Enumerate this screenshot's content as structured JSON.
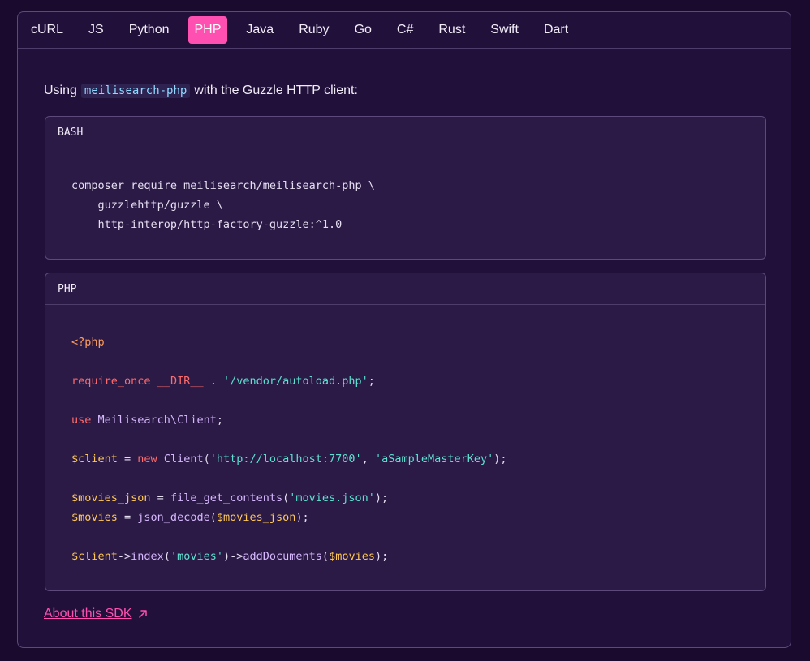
{
  "tabs": [
    "cURL",
    "JS",
    "Python",
    "PHP",
    "Java",
    "Ruby",
    "Go",
    "C#",
    "Rust",
    "Swift",
    "Dart"
  ],
  "active_tab": "PHP",
  "intro": {
    "prefix": "Using",
    "package": "meilisearch-php",
    "suffix": "with the Guzzle HTTP client:"
  },
  "bash_block": {
    "label": "BASH",
    "lines": [
      "composer require meilisearch/meilisearch-php \\",
      "    guzzlehttp/guzzle \\",
      "    http-interop/http-factory-guzzle:^1.0"
    ]
  },
  "php_block": {
    "label": "PHP",
    "lines": [
      [
        {
          "t": "<?php",
          "c": "tag"
        }
      ],
      [],
      [
        {
          "t": "require_once",
          "c": "kw"
        },
        {
          "t": " ",
          "c": "plain"
        },
        {
          "t": "__DIR__",
          "c": "kw"
        },
        {
          "t": " . ",
          "c": "plain"
        },
        {
          "t": "'/vendor/autoload.php'",
          "c": "str"
        },
        {
          "t": ";",
          "c": "plain"
        }
      ],
      [],
      [
        {
          "t": "use",
          "c": "kw"
        },
        {
          "t": " ",
          "c": "plain"
        },
        {
          "t": "Meilisearch\\Client",
          "c": "fn"
        },
        {
          "t": ";",
          "c": "plain"
        }
      ],
      [],
      [
        {
          "t": "$client",
          "c": "var"
        },
        {
          "t": " = ",
          "c": "plain"
        },
        {
          "t": "new",
          "c": "kw"
        },
        {
          "t": " ",
          "c": "plain"
        },
        {
          "t": "Client",
          "c": "fn"
        },
        {
          "t": "(",
          "c": "plain"
        },
        {
          "t": "'http://localhost:7700'",
          "c": "str"
        },
        {
          "t": ", ",
          "c": "plain"
        },
        {
          "t": "'aSampleMasterKey'",
          "c": "str"
        },
        {
          "t": ");",
          "c": "plain"
        }
      ],
      [],
      [
        {
          "t": "$movies_json",
          "c": "var"
        },
        {
          "t": " = ",
          "c": "plain"
        },
        {
          "t": "file_get_contents",
          "c": "fn"
        },
        {
          "t": "(",
          "c": "plain"
        },
        {
          "t": "'movies.json'",
          "c": "str"
        },
        {
          "t": ");",
          "c": "plain"
        }
      ],
      [
        {
          "t": "$movies",
          "c": "var"
        },
        {
          "t": " = ",
          "c": "plain"
        },
        {
          "t": "json_decode",
          "c": "fn"
        },
        {
          "t": "(",
          "c": "plain"
        },
        {
          "t": "$movies_json",
          "c": "var"
        },
        {
          "t": ");",
          "c": "plain"
        }
      ],
      [],
      [
        {
          "t": "$client",
          "c": "var"
        },
        {
          "t": "->",
          "c": "plain"
        },
        {
          "t": "index",
          "c": "fn"
        },
        {
          "t": "(",
          "c": "plain"
        },
        {
          "t": "'movies'",
          "c": "str"
        },
        {
          "t": ")->",
          "c": "plain"
        },
        {
          "t": "addDocuments",
          "c": "fn"
        },
        {
          "t": "(",
          "c": "plain"
        },
        {
          "t": "$movies",
          "c": "var"
        },
        {
          "t": ");",
          "c": "plain"
        }
      ]
    ]
  },
  "about_link": {
    "label": "About this SDK",
    "icon": "arrow-up-right-icon"
  },
  "colors": {
    "accent": "#ff4fb0",
    "background": "#1a0b2e",
    "panel": "#21113a"
  }
}
